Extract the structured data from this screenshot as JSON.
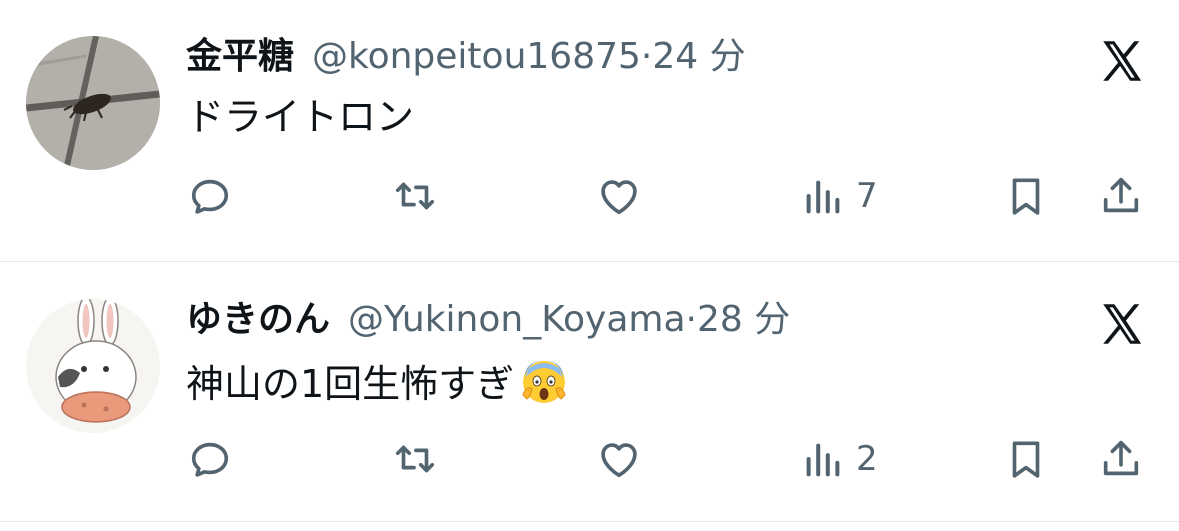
{
  "tweets": [
    {
      "name": "金平糖",
      "handle": "@konpeitou16875",
      "separator": "·",
      "time": "24 分",
      "text": "ドライトロン",
      "views": "7",
      "avatar": "photo-avatar"
    },
    {
      "name": "ゆきのん",
      "handle": "@Yukinon_Koyama",
      "separator": "·",
      "time": "28 分",
      "text": "神山の1回生怖すぎ",
      "emoji": "face-screaming-in-fear",
      "views": "2",
      "avatar": "rabbit-illustration-avatar"
    }
  ],
  "icons": {
    "reply": "reply-icon",
    "retweet": "retweet-icon",
    "like": "heart-icon",
    "views": "analytics-icon",
    "bookmark": "bookmark-icon",
    "share": "share-icon",
    "brand": "x-logo-icon"
  },
  "colors": {
    "text": "#0f1419",
    "secondary": "#536471",
    "divider": "#e4e7ea"
  }
}
